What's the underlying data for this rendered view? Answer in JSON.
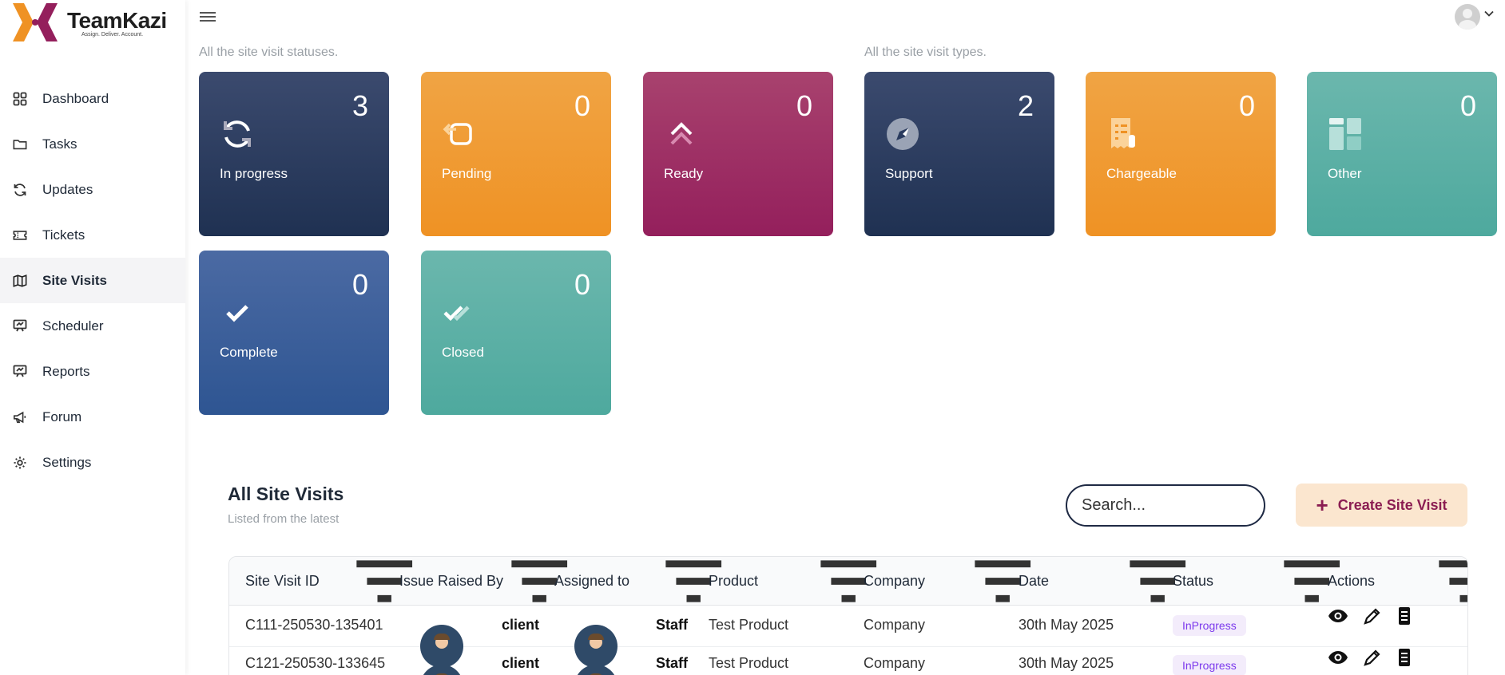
{
  "brand": {
    "name": "TeamKazi",
    "tagline": "Assign. Deliver. Account."
  },
  "sidebar": {
    "items": [
      {
        "label": "Dashboard",
        "icon": "grid-icon"
      },
      {
        "label": "Tasks",
        "icon": "folder-icon"
      },
      {
        "label": "Updates",
        "icon": "refresh-icon"
      },
      {
        "label": "Tickets",
        "icon": "ticket-icon"
      },
      {
        "label": "Site Visits",
        "icon": "map-icon",
        "active": true
      },
      {
        "label": "Scheduler",
        "icon": "presentation-icon"
      },
      {
        "label": "Reports",
        "icon": "presentation-icon"
      },
      {
        "label": "Forum",
        "icon": "megaphone-icon"
      },
      {
        "label": "Settings",
        "icon": "gear-icon"
      }
    ]
  },
  "statuses": {
    "subtitle": "All the site visit statuses.",
    "cards": [
      {
        "label": "In progress",
        "count": "3",
        "icon": "refresh-icon",
        "color": "#2a3b5e"
      },
      {
        "label": "Pending",
        "count": "0",
        "icon": "return-icon",
        "color": "#ef9a30"
      },
      {
        "label": "Ready",
        "count": "0",
        "icon": "double-chevron-up-icon",
        "color": "#9c2e64"
      },
      {
        "label": "Complete",
        "count": "0",
        "icon": "check-icon",
        "color": "#3a5f9c"
      },
      {
        "label": "Closed",
        "count": "0",
        "icon": "double-check-icon",
        "color": "#5db0a5"
      }
    ]
  },
  "types": {
    "subtitle": "All the site visit types.",
    "cards": [
      {
        "label": "Support",
        "count": "2",
        "icon": "compass-icon",
        "color": "#2a3b5e"
      },
      {
        "label": "Chargeable",
        "count": "0",
        "icon": "receipt-icon",
        "color": "#ef9a30"
      },
      {
        "label": "Other",
        "count": "0",
        "icon": "layout-icon",
        "color": "#5db0a5"
      }
    ]
  },
  "table": {
    "title": "All Site Visits",
    "subtitle": "Listed from the latest",
    "search_placeholder": "Search...",
    "create_label": "Create Site Visit",
    "columns": [
      "Site Visit ID",
      "Issue Raised By",
      "Assigned to",
      "Product",
      "Company",
      "Date",
      "Status",
      "Actions"
    ],
    "rows": [
      {
        "id": "C111-250530-135401",
        "raised_by": "client",
        "assigned_to": "Staff",
        "product": "Test Product",
        "company": "Company",
        "date": "30th May 2025",
        "status": "InProgress"
      },
      {
        "id": "C121-250530-133645",
        "raised_by": "client",
        "assigned_to": "Staff",
        "product": "Test Product",
        "company": "Company",
        "date": "30th May 2025",
        "status": "InProgress"
      }
    ]
  }
}
